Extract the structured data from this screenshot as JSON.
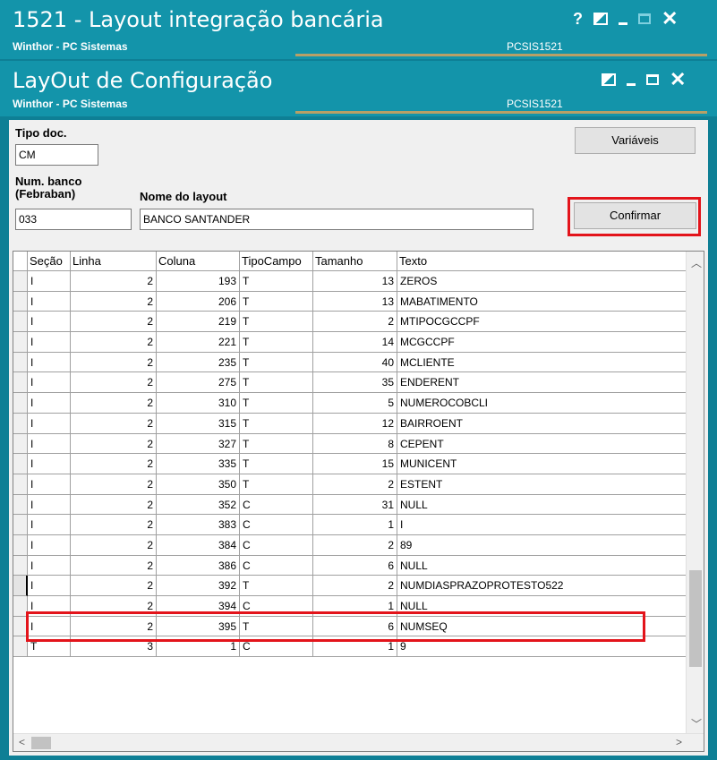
{
  "outer_window": {
    "title": "1521 - Layout integração bancária",
    "subtitle": "Winthor - PC Sistemas",
    "code": "PCSIS1521",
    "help_label": "?"
  },
  "inner_window": {
    "title": "LayOut de Configuração",
    "subtitle": "Winthor - PC Sistemas",
    "code": "PCSIS1521"
  },
  "form": {
    "tipo_doc_label": "Tipo doc.",
    "tipo_doc_value": "CM",
    "num_banco_label1": "Num. banco",
    "num_banco_label2": "(Febraban)",
    "num_banco_value": "033",
    "nome_layout_label": "Nome do layout",
    "nome_layout_value": "BANCO SANTANDER",
    "variaveis_button": "Variáveis",
    "confirmar_button": "Confirmar",
    "highlight_color": "#e3141b"
  },
  "grid": {
    "columns": [
      "Seção",
      "Linha",
      "Coluna",
      "TipoCampo",
      "Tamanho",
      "Texto"
    ],
    "rows": [
      {
        "secao": "I",
        "linha": "2",
        "coluna": "193",
        "tipo": "T",
        "tamanho": "13",
        "texto": "ZEROS"
      },
      {
        "secao": "I",
        "linha": "2",
        "coluna": "206",
        "tipo": "T",
        "tamanho": "13",
        "texto": "MABATIMENTO"
      },
      {
        "secao": "I",
        "linha": "2",
        "coluna": "219",
        "tipo": "T",
        "tamanho": "2",
        "texto": "MTIPOCGCCPF"
      },
      {
        "secao": "I",
        "linha": "2",
        "coluna": "221",
        "tipo": "T",
        "tamanho": "14",
        "texto": "MCGCCPF"
      },
      {
        "secao": "I",
        "linha": "2",
        "coluna": "235",
        "tipo": "T",
        "tamanho": "40",
        "texto": "MCLIENTE"
      },
      {
        "secao": "I",
        "linha": "2",
        "coluna": "275",
        "tipo": "T",
        "tamanho": "35",
        "texto": "ENDERENT"
      },
      {
        "secao": "I",
        "linha": "2",
        "coluna": "310",
        "tipo": "T",
        "tamanho": "5",
        "texto": "NUMEROCOBCLI"
      },
      {
        "secao": "I",
        "linha": "2",
        "coluna": "315",
        "tipo": "T",
        "tamanho": "12",
        "texto": "BAIRROENT"
      },
      {
        "secao": "I",
        "linha": "2",
        "coluna": "327",
        "tipo": "T",
        "tamanho": "8",
        "texto": "CEPENT"
      },
      {
        "secao": "I",
        "linha": "2",
        "coluna": "335",
        "tipo": "T",
        "tamanho": "15",
        "texto": "MUNICENT"
      },
      {
        "secao": "I",
        "linha": "2",
        "coluna": "350",
        "tipo": "T",
        "tamanho": "2",
        "texto": "ESTENT"
      },
      {
        "secao": "I",
        "linha": "2",
        "coluna": "352",
        "tipo": "C",
        "tamanho": "31",
        "texto": "NULL"
      },
      {
        "secao": "I",
        "linha": "2",
        "coluna": "383",
        "tipo": "C",
        "tamanho": "1",
        "texto": "I"
      },
      {
        "secao": "I",
        "linha": "2",
        "coluna": "384",
        "tipo": "C",
        "tamanho": "2",
        "texto": "89"
      },
      {
        "secao": "I",
        "linha": "2",
        "coluna": "386",
        "tipo": "C",
        "tamanho": "6",
        "texto": "NULL"
      },
      {
        "secao": "I",
        "linha": "2",
        "coluna": "392",
        "tipo": "T",
        "tamanho": "2",
        "texto": "NUMDIASPRAZOPROTESTO522"
      },
      {
        "secao": "I",
        "linha": "2",
        "coluna": "394",
        "tipo": "C",
        "tamanho": "1",
        "texto": "NULL"
      },
      {
        "secao": "I",
        "linha": "2",
        "coluna": "395",
        "tipo": "T",
        "tamanho": "6",
        "texto": "NUMSEQ"
      },
      {
        "secao": "T",
        "linha": "3",
        "coluna": "1",
        "tipo": "C",
        "tamanho": "1",
        "texto": "9"
      }
    ],
    "current_row_index": 15
  }
}
